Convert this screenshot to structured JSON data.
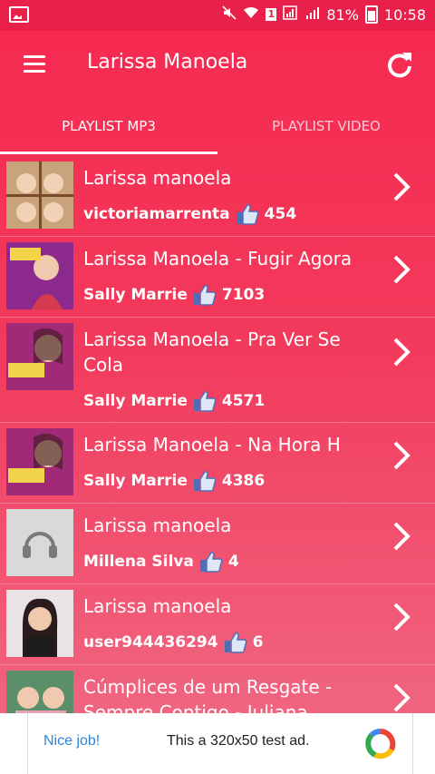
{
  "status_bar": {
    "battery_text": "81%",
    "time": "10:58",
    "sim_label": "1"
  },
  "toolbar": {
    "title": "Larissa Manoela",
    "menu_icon": "hamburger-menu-icon",
    "refresh_icon": "refresh-icon"
  },
  "tabs": [
    {
      "label": "PLAYLIST MP3",
      "selected": true
    },
    {
      "label": "PLAYLIST VIDEO",
      "selected": false
    }
  ],
  "items": [
    {
      "title": "Larissa manoela",
      "uploader": "victoriamarrenta",
      "likes": "454"
    },
    {
      "title": "Larissa Manoela -  Fugir Agora",
      "uploader": "Sally Marrie",
      "likes": "7103"
    },
    {
      "title": "Larissa Manoela - Pra Ver Se Cola",
      "uploader": "Sally Marrie",
      "likes": "4571"
    },
    {
      "title": "Larissa Manoela -  Na Hora H",
      "uploader": "Sally Marrie",
      "likes": "4386"
    },
    {
      "title": "Larissa manoela",
      "uploader": "Millena Silva",
      "likes": "4"
    },
    {
      "title": "Larissa manoela",
      "uploader": "user944436294",
      "likes": "6"
    },
    {
      "title": "Cúmplices de um Resgate - Sempre Contigo - Juliana",
      "uploader": "",
      "likes": ""
    }
  ],
  "ad": {
    "nice_label": "Nice job!",
    "text": "This a 320x50 test ad."
  },
  "colors": {
    "accent": "#f7284f",
    "ad_link": "#2d86d9",
    "like_icon": "#4d6fb8"
  }
}
